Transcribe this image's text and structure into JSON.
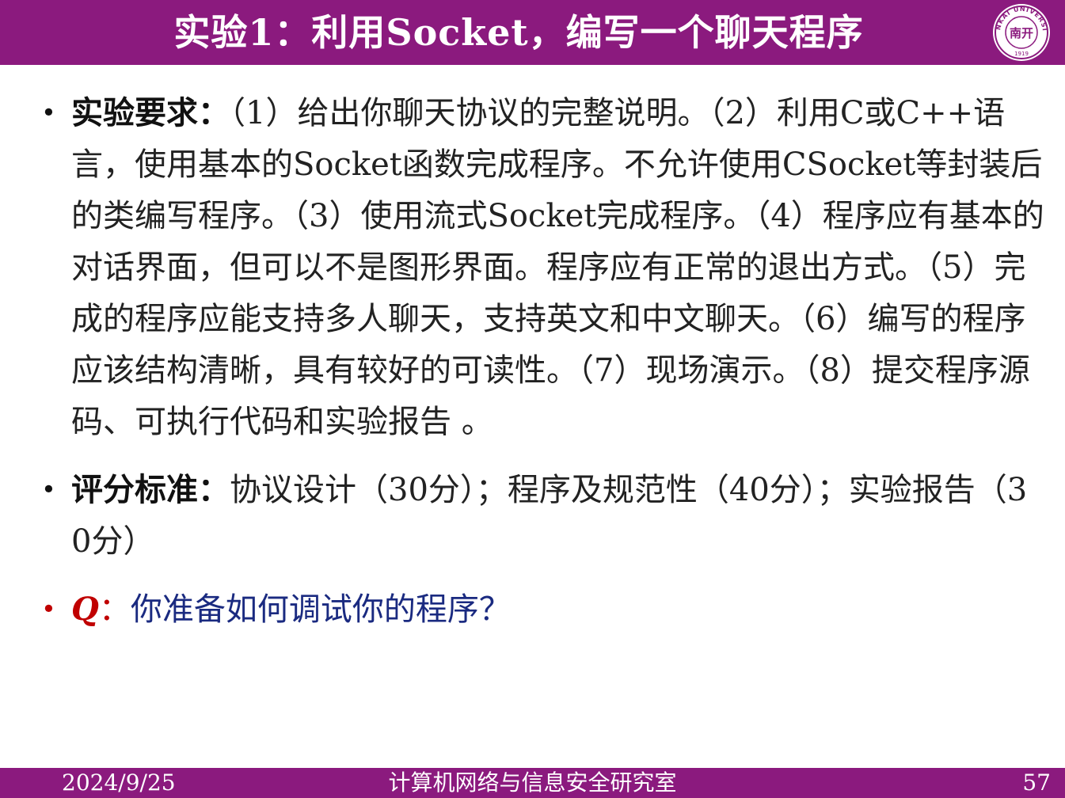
{
  "header": {
    "title": "实验1：利用Socket，编写一个聊天程序",
    "logo": {
      "icon": "university-seal-icon",
      "text": "NANKAI UNIVERSITY",
      "year": "1919",
      "center_text": "南开"
    }
  },
  "items": [
    {
      "label": "实验要求：",
      "text": "（1）给出你聊天协议的完整说明。（2）利用C或C++语言，使用基本的Socket函数完成程序。不允许使用CSocket等封装后的类编写程序。（3）使用流式Socket完成程序。（4）程序应有基本的对话界面，但可以不是图形界面。程序应有正常的退出方式。（5）完成的程序应能支持多人聊天，支持英文和中文聊天。（6）编写的程序应该结构清晰，具有较好的可读性。（7）现场演示。（8）提交程序源码、可执行代码和实验报告 。"
    },
    {
      "label": "评分标准：",
      "text": "协议设计（30分）；程序及规范性（40分）；实验报告（30分）"
    }
  ],
  "question": {
    "letter": "Q",
    "colon": "：",
    "text": "你准备如何调试你的程序？"
  },
  "footer": {
    "date": "2024/9/25",
    "org": "计算机网络与信息安全研究室",
    "page": "57"
  },
  "colors": {
    "brand": "#8b1a7e",
    "question_accent": "#c00000",
    "question_text": "#1a2a80"
  }
}
